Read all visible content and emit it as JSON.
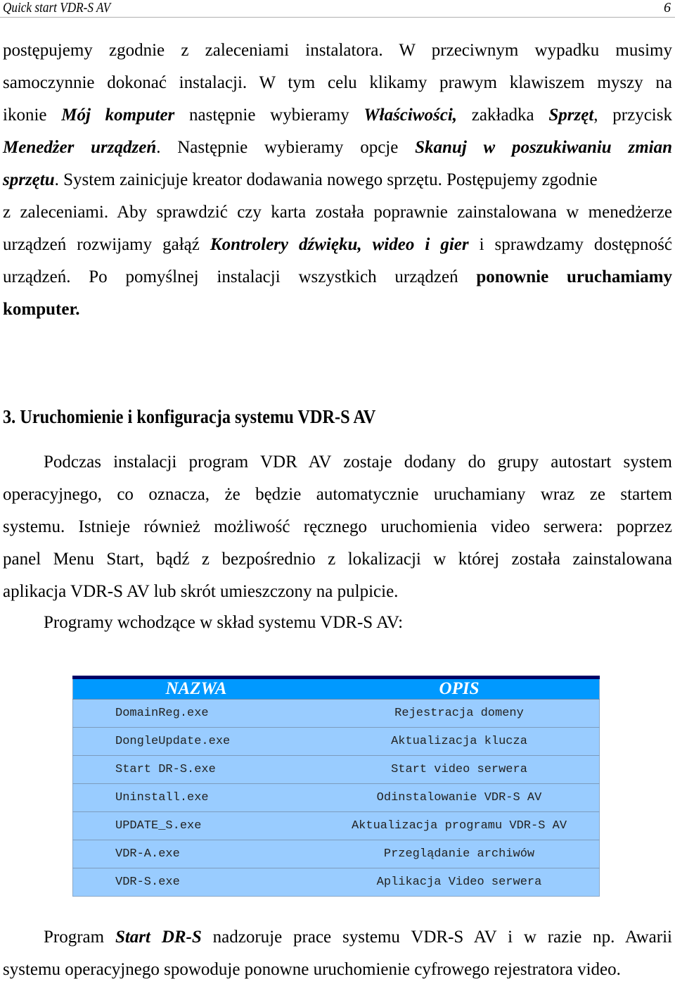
{
  "header": {
    "title": "Quick start VDR-S AV",
    "page_number": "6"
  },
  "para1": {
    "l1": "postępujemy zgodnie z zaleceniami instalatora. W przeciwnym wypadku musimy",
    "l2": "samoczynnie dokonać instalacji. W tym celu klikamy prawym klawiszem myszy na",
    "l3a": "ikonie ",
    "l3b": "Mój komputer",
    "l3c": " następnie wybieramy ",
    "l3d": "Właściwości,",
    "l3e": " zakładka ",
    "l3f": "Sprzęt",
    "l3g": ", przycisk",
    "l4a": "Menedżer urządzeń",
    "l4b": ". Następnie wybieramy opcje ",
    "l4c": "Skanuj w poszukiwaniu zmian",
    "l5a": "sprzętu",
    "l5b": ". System zainicjuje kreator dodawania nowego sprzętu. Postępujemy zgodnie",
    "l6": "z zaleceniami. Aby sprawdzić czy karta została poprawnie zainstalowana w menedżerze",
    "l7a": "urządzeń rozwijamy gałąź ",
    "l7b": "Kontrolery dźwięku, wideo i gier",
    "l7c": "  i sprawdzamy dostępność",
    "l8a": "urządzeń. Po pomyślnej instalacji wszystkich urządzeń ",
    "l8b": "ponownie uruchamiamy",
    "l9": "komputer."
  },
  "section": {
    "heading": "3. Uruchomienie i konfiguracja systemu VDR-S AV"
  },
  "para2": {
    "l1": "Podczas instalacji program VDR AV zostaje dodany do grupy autostart system",
    "l2": "operacyjnego, co oznacza, że będzie automatycznie uruchamiany wraz ze startem",
    "l3": "systemu. Istnieje również możliwość ręcznego uruchomienia video serwera: poprzez",
    "l4": "panel Menu Start, bądź z bezpośrednio z lokalizacji w której została zainstalowana",
    "l5": "aplikacja VDR-S AV lub skrót umieszczony na pulpicie."
  },
  "para3": {
    "l1": "Programy wchodzące w skład systemu VDR-S AV:"
  },
  "table": {
    "headers": [
      "NAZWA",
      "OPIS"
    ],
    "rows": [
      {
        "name": "DomainReg.exe",
        "desc": "Rejestracja domeny"
      },
      {
        "name": "DongleUpdate.exe",
        "desc": "Aktualizacja klucza"
      },
      {
        "name": "Start DR-S.exe",
        "desc": "Start video serwera"
      },
      {
        "name": "Uninstall.exe",
        "desc": "Odinstalowanie VDR-S AV"
      },
      {
        "name": "UPDATE_S.exe",
        "desc": "Aktualizacja programu VDR-S AV"
      },
      {
        "name": "VDR-A.exe",
        "desc": "Przeglądanie archiwów"
      },
      {
        "name": "VDR-S.exe",
        "desc": "Aplikacja Video serwera"
      }
    ],
    "colors": {
      "top_bar": "#000066",
      "header_bg": "#0099ff",
      "row_bg": "#99ccff"
    }
  },
  "para4": {
    "l1a": "Program ",
    "l1b": "Start DR-S",
    "l1c": "  nadzoruje prace systemu VDR-S AV i w razie np. Awarii",
    "l2": "systemu operacyjnego spowoduje ponowne uruchomienie cyfrowego rejestratora video."
  }
}
